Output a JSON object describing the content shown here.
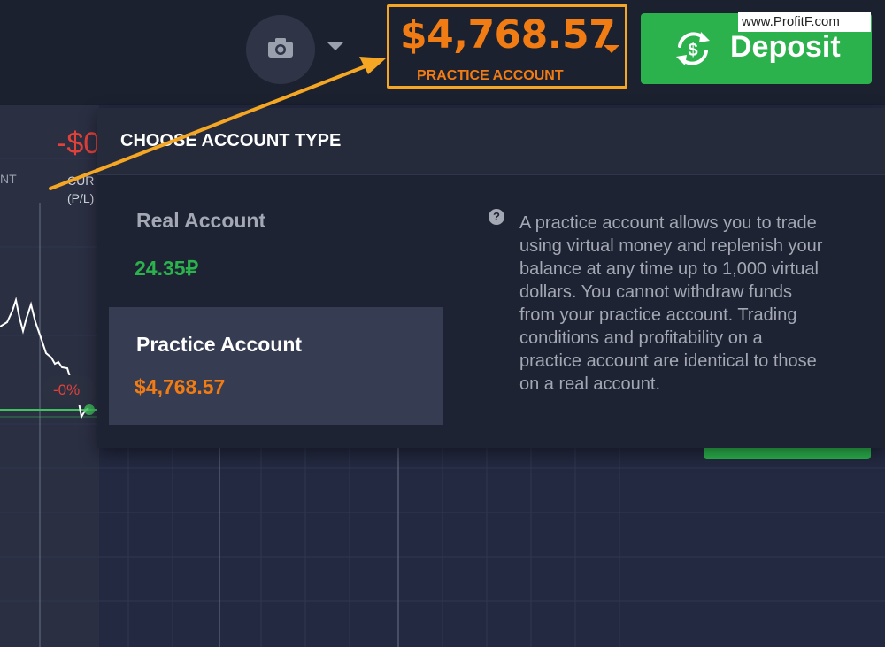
{
  "header": {
    "balance": "$4,768.57",
    "account_label": "PRACTICE ACCOUNT",
    "deposit_label": "Deposit",
    "watermark": "www.ProfitF.com"
  },
  "chart": {
    "pnl_value": "-$0",
    "left_label": "NT",
    "pnl_label_line1": "CUR",
    "pnl_label_line2": "(P/L)",
    "pct_badge": "-0%"
  },
  "dropdown": {
    "title": "CHOOSE ACCOUNT TYPE",
    "accounts": [
      {
        "name": "Real Account",
        "balance": "24.35₽"
      },
      {
        "name": "Practice Account",
        "balance": "$4,768.57"
      }
    ],
    "help_text": "A practice account allows you to trade using virtual money and replenish your balance at any time up to 1,000 virtual dollars. You cannot withdraw funds from your practice account. Trading conditions and profitability on a practice account are identical to those on a real account."
  },
  "colors": {
    "accent_orange": "#f07c13",
    "annotation_yellow": "#f5a623",
    "deposit_green": "#2bb24c",
    "loss_red": "#e2413a"
  },
  "icons": {
    "camera": "camera-icon",
    "caret": "chevron-down-icon",
    "deposit": "dollar-refresh-icon",
    "help": "question-icon"
  }
}
